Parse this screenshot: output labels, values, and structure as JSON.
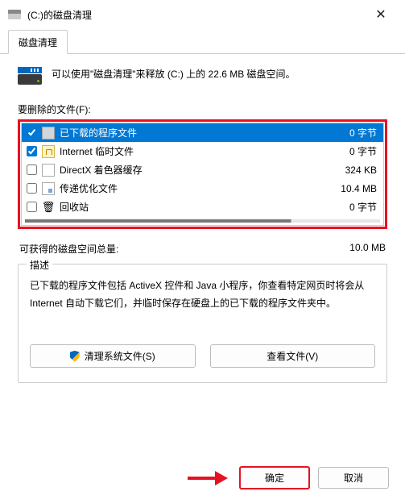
{
  "titlebar": {
    "title": "(C:)的磁盘清理"
  },
  "tab": {
    "label": "磁盘清理"
  },
  "intro": "可以使用\"磁盘清理\"来释放  (C:) 上的 22.6 MB 磁盘空间。",
  "list_label": "要删除的文件(F):",
  "files": [
    {
      "name": "已下载的程序文件",
      "size": "0 字节",
      "checked": true,
      "selected": true,
      "icon": "app"
    },
    {
      "name": "Internet 临时文件",
      "size": "0 字节",
      "checked": true,
      "selected": false,
      "icon": "lock"
    },
    {
      "name": "DirectX 着色器缓存",
      "size": "324 KB",
      "checked": false,
      "selected": false,
      "icon": "file"
    },
    {
      "name": "传递优化文件",
      "size": "10.4 MB",
      "checked": false,
      "selected": false,
      "icon": "fileblue"
    },
    {
      "name": "回收站",
      "size": "0 字节",
      "checked": false,
      "selected": false,
      "icon": "trash"
    }
  ],
  "gain": {
    "label": "可获得的磁盘空间总量:",
    "value": "10.0 MB"
  },
  "description": {
    "legend": "描述",
    "text": "已下载的程序文件包括 ActiveX 控件和 Java 小程序，你查看特定网页时将会从 Internet 自动下载它们，并临时保存在硬盘上的已下载的程序文件夹中。"
  },
  "buttons": {
    "clean_system": "清理系统文件(S)",
    "view_files": "查看文件(V)",
    "ok": "确定",
    "cancel": "取消"
  }
}
